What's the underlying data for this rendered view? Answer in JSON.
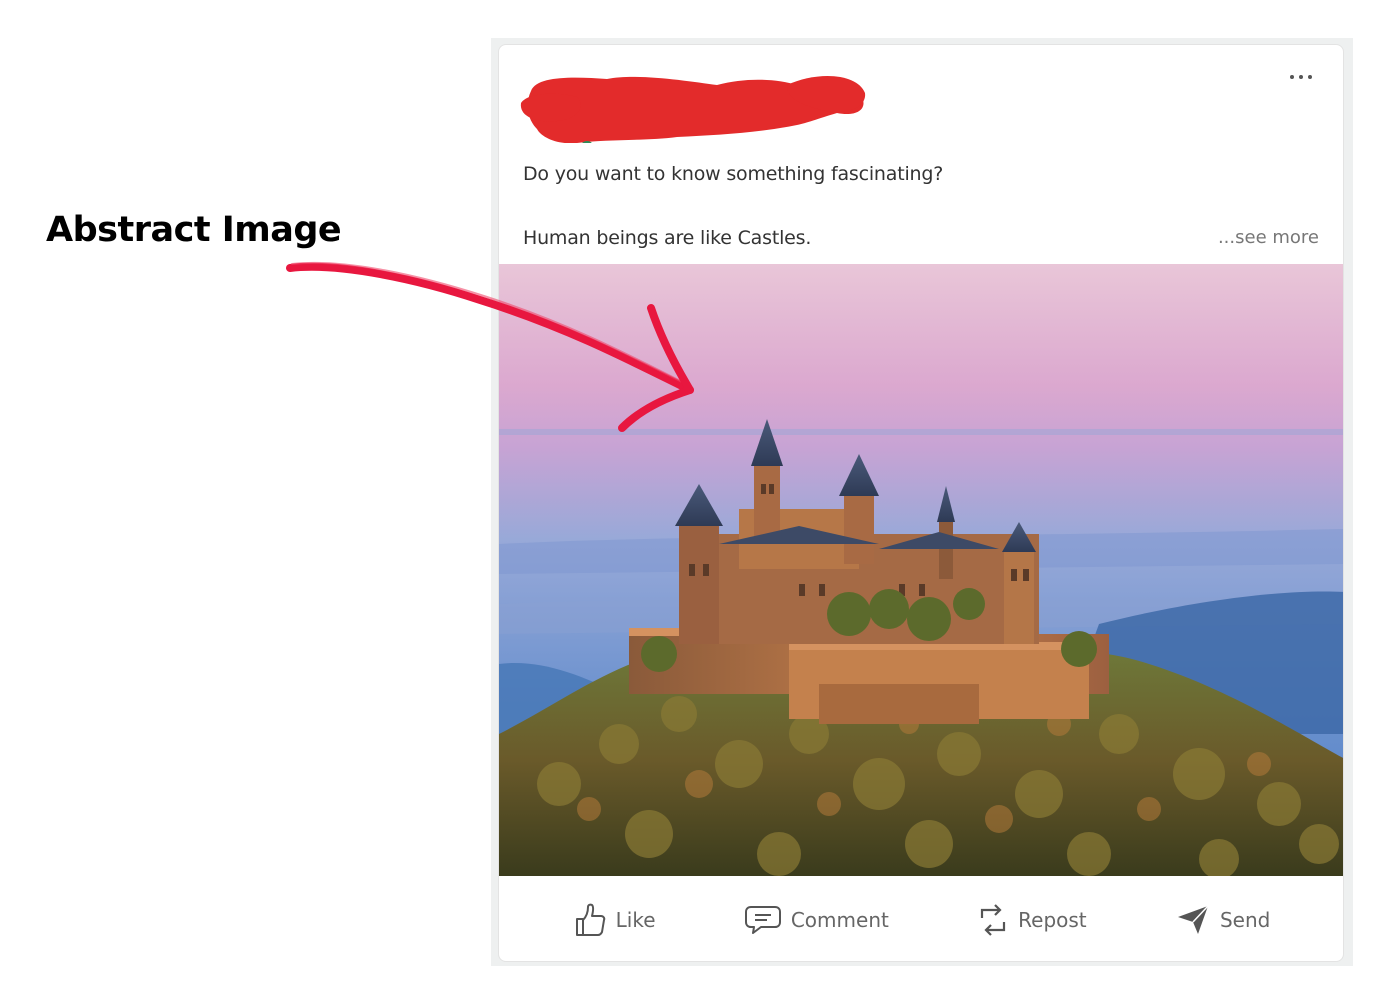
{
  "annotation": {
    "label": "Abstract Image",
    "arrow_color": "#e8173f"
  },
  "post": {
    "author_redaction_color": "#e32b2b",
    "more_menu_icon": "more-horizontal-icon",
    "text_line1": "Do you want to know something fascinating?",
    "text_line2": "Human beings are like Castles.",
    "see_more": "...see more",
    "image_subject": "castle on forested hill at sunset"
  },
  "actions": [
    {
      "label": "Like",
      "icon": "thumbs-up-icon"
    },
    {
      "label": "Comment",
      "icon": "comment-icon"
    },
    {
      "label": "Repost",
      "icon": "repost-icon"
    },
    {
      "label": "Send",
      "icon": "send-icon"
    }
  ],
  "colors": {
    "text": "#333333",
    "muted": "#666666",
    "card_border": "#e3e3e3"
  }
}
